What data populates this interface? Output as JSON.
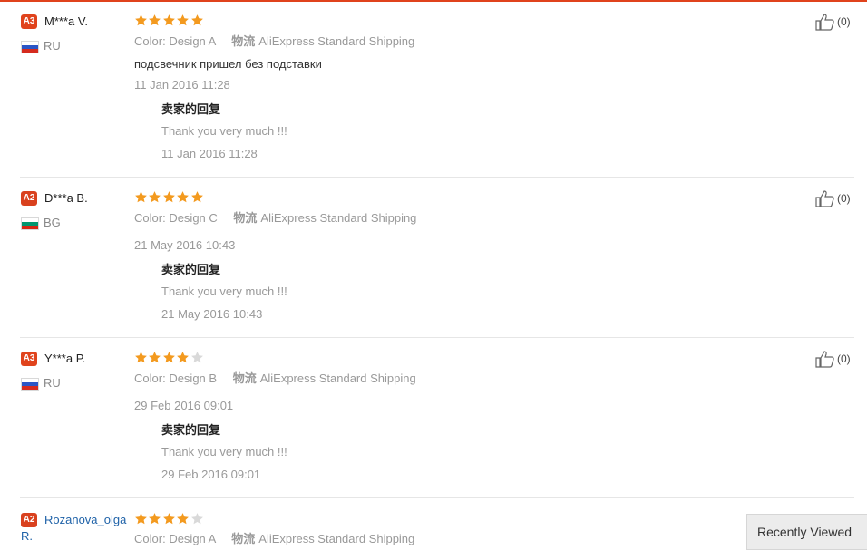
{
  "labels": {
    "color": "Color:",
    "shipping": "物流",
    "seller_reply": "卖家的回复",
    "recently_viewed": "Recently Viewed"
  },
  "colors": {
    "accent": "#e0431c",
    "star_filled": "#f39a1f",
    "star_empty": "#d9d9d9",
    "badge_a3": "#e0431c",
    "badge_a2": "#d9411e",
    "link": "#1f62a8"
  },
  "reviews": [
    {
      "badge": "A3",
      "username": "M***a V.",
      "country": "RU",
      "flag": "russia-flag",
      "rating": 5,
      "color_value": "Design A",
      "shipping_value": "AliExpress Standard Shipping",
      "text": "подсвечник пришел без подставки",
      "date": "11 Jan 2016 11:28",
      "reply_text": "Thank you very much !!!",
      "reply_date": "11 Jan 2016 11:28",
      "helpful_count": "(0)"
    },
    {
      "badge": "A2",
      "username": "D***a B.",
      "country": "BG",
      "flag": "bulgaria-flag",
      "rating": 5,
      "color_value": "Design C",
      "shipping_value": "AliExpress Standard Shipping",
      "text": "",
      "date": "21 May 2016 10:43",
      "reply_text": "Thank you very much !!!",
      "reply_date": "21 May 2016 10:43",
      "helpful_count": "(0)"
    },
    {
      "badge": "A3",
      "username": "Y***a P.",
      "country": "RU",
      "flag": "russia-flag",
      "rating": 4,
      "color_value": "Design B",
      "shipping_value": "AliExpress Standard Shipping",
      "text": "",
      "date": "29 Feb 2016 09:01",
      "reply_text": "Thank you very much !!!",
      "reply_date": "29 Feb 2016 09:01",
      "helpful_count": "(0)"
    },
    {
      "badge": "A2",
      "username": "Rozanova_olga",
      "username_line2": "R.",
      "rating": 4,
      "color_value": "Design A",
      "shipping_value": "AliExpress Standard Shipping"
    }
  ]
}
